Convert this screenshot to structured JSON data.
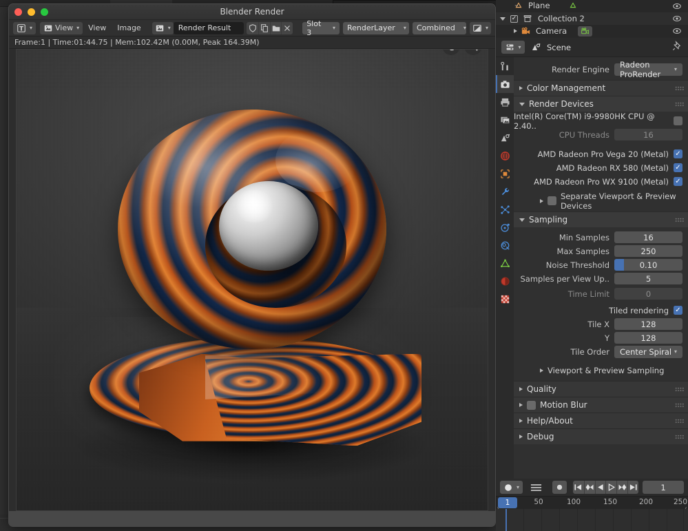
{
  "window": {
    "title": "Blender Render",
    "traffic_lights": [
      "close",
      "minimize",
      "zoom"
    ]
  },
  "image_editor_header": {
    "editor_type_icon": "image-editor-icon",
    "view_menu_icon": "image-icon",
    "menus": [
      "View",
      "Image"
    ],
    "view_label": "View",
    "datablock_icon": "image-datablock-icon",
    "datablock_name": "Render Result",
    "fake_user_icon": "shield-icon",
    "new_icon": "copy-icon",
    "open_icon": "folder-icon",
    "unlink_icon": "x-icon",
    "slot": "Slot 3",
    "layer": "RenderLayer",
    "pass": "Combined",
    "display_icon": "display-channel-icon"
  },
  "stats": {
    "text": "Frame:1 | Time:01:44.75 | Mem:102.42M (0.00M, Peak 164.39M)"
  },
  "gizmos": [
    {
      "name": "pan-gizmo",
      "glyph": "✋"
    },
    {
      "name": "zoom-gizmo",
      "glyph": "🔍"
    }
  ],
  "outliner": {
    "rows": [
      {
        "name": "Plane",
        "indent": 1,
        "icon": "mesh-data-icon",
        "extra_icon": "mesh-object-icon",
        "visible": true,
        "partial": true
      },
      {
        "name": "Collection 2",
        "indent": 0,
        "icon": "collection-icon",
        "checkbox": true,
        "expanded": true,
        "visible": true
      },
      {
        "name": "Camera",
        "indent": 1,
        "icon": "camera-object-icon",
        "extra_icon": "camera-data-icon",
        "visible": true
      }
    ]
  },
  "properties": {
    "header": {
      "editor_icon": "properties-editor-icon",
      "breadcrumb_icon": "scene-icon",
      "breadcrumb": "Scene",
      "pin_icon": "pin-icon"
    },
    "tabs": [
      {
        "name": "tool",
        "icon": "tool-icon",
        "selected": false
      },
      {
        "name": "render",
        "icon": "camera-back-icon",
        "selected": true
      },
      {
        "name": "output",
        "icon": "printer-icon",
        "selected": false
      },
      {
        "name": "view-layer",
        "icon": "images-icon",
        "selected": false
      },
      {
        "name": "scene",
        "icon": "scene-icon",
        "selected": false
      },
      {
        "name": "world",
        "icon": "world-icon",
        "selected": false
      },
      {
        "name": "object",
        "icon": "object-square-icon",
        "selected": false
      },
      {
        "name": "modifiers",
        "icon": "wrench-icon",
        "selected": false
      },
      {
        "name": "particles",
        "icon": "particles-icon",
        "selected": false
      },
      {
        "name": "physics",
        "icon": "physics-icon",
        "selected": false
      },
      {
        "name": "constraints",
        "icon": "constraint-icon",
        "selected": false
      },
      {
        "name": "data",
        "icon": "mesh-data-triangle-icon",
        "selected": false
      },
      {
        "name": "material",
        "icon": "material-sphere-icon",
        "selected": false
      },
      {
        "name": "texture",
        "icon": "texture-checker-icon",
        "selected": false
      }
    ],
    "render_engine": {
      "label": "Render Engine",
      "value": "Radeon ProRender"
    },
    "color_management": {
      "label": "Color Management",
      "expanded": false
    },
    "render_devices": {
      "label": "Render Devices",
      "expanded": true,
      "cpu": {
        "label": "Intel(R) Core(TM) i9-9980HK CPU @ 2.40..",
        "checked": false
      },
      "cpu_threads": {
        "label": "CPU Threads",
        "value": "16"
      },
      "gpus": [
        {
          "label": "AMD Radeon Pro Vega 20 (Metal)",
          "checked": true
        },
        {
          "label": "AMD Radeon RX 580 (Metal)",
          "checked": true
        },
        {
          "label": "AMD Radeon Pro WX 9100 (Metal)",
          "checked": true
        }
      ],
      "separate_viewport": {
        "label": "Separate Viewport & Preview Devices",
        "checked": false
      }
    },
    "sampling": {
      "label": "Sampling",
      "expanded": true,
      "fields": [
        {
          "label": "Min Samples",
          "value": "16",
          "dim": false,
          "slider": false
        },
        {
          "label": "Max Samples",
          "value": "250",
          "dim": false,
          "slider": false
        },
        {
          "label": "Noise Threshold",
          "value": "0.10",
          "dim": false,
          "slider": true
        },
        {
          "label": "Samples per View Up..",
          "value": "5",
          "dim": false,
          "slider": false
        },
        {
          "label": "Time Limit",
          "value": "0",
          "dim": true,
          "slider": false
        }
      ],
      "tiled_rendering": {
        "label": "Tiled rendering",
        "checked": true
      },
      "tile_x": {
        "label": "Tile X",
        "value": "128"
      },
      "tile_y": {
        "label": "Y",
        "value": "128"
      },
      "tile_order": {
        "label": "Tile Order",
        "value": "Center Spiral"
      },
      "viewport_preview_sampling": {
        "label": "Viewport & Preview Sampling",
        "expanded": false
      }
    },
    "panels": [
      {
        "label": "Quality",
        "expanded": false,
        "checkbox": false
      },
      {
        "label": "Motion Blur",
        "expanded": false,
        "checkbox": true,
        "checked": false
      },
      {
        "label": "Help/About",
        "expanded": false,
        "checkbox": false
      },
      {
        "label": "Debug",
        "expanded": false,
        "checkbox": false
      }
    ]
  },
  "timeline": {
    "editor_icon": "timeline-editor-icon",
    "menu_icon": "hamburger-icon",
    "record_icon": "record-icon",
    "transport": [
      {
        "name": "jump-to-start-button",
        "glyph": "start"
      },
      {
        "name": "prev-keyframe-button",
        "glyph": "prevkey"
      },
      {
        "name": "play-reverse-button",
        "glyph": "playrev"
      },
      {
        "name": "play-button",
        "glyph": "play"
      },
      {
        "name": "next-keyframe-button",
        "glyph": "nextkey"
      },
      {
        "name": "jump-to-end-button",
        "glyph": "end"
      }
    ],
    "current_frame": "1",
    "ruler_ticks": [
      "50",
      "100",
      "150",
      "200",
      "250"
    ],
    "playhead_label": "1"
  },
  "colors": {
    "accent": "#4772b3",
    "panel_bg": "#303030",
    "header_bg": "#2b2b2b",
    "field_bg": "#545454",
    "text": "#d2d2d2"
  }
}
